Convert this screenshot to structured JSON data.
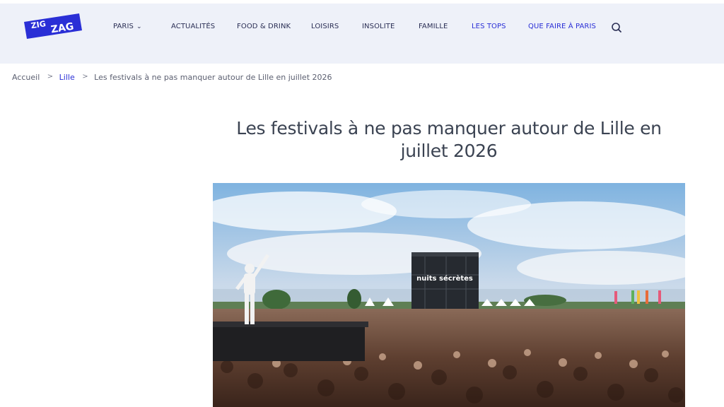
{
  "logo": {
    "line1": "ZIG",
    "line2": "ZAG"
  },
  "nav": [
    {
      "label": "PARIS",
      "dropdown": true
    },
    {
      "label": "ACTUALITÉS"
    },
    {
      "label": "FOOD & DRINK"
    },
    {
      "label": "LOISIRS"
    },
    {
      "label": "INSOLITE"
    },
    {
      "label": "FAMILLE"
    },
    {
      "label": "LES TOPS",
      "accent": true
    },
    {
      "label": "QUE FAIRE À PARIS",
      "accent": true
    }
  ],
  "breadcrumb": {
    "home": "Accueil",
    "section": "Lille",
    "current": "Les festivals à ne pas manquer autour de Lille en juillet 2026",
    "separator": ">"
  },
  "article": {
    "title": "Les festivals à ne pas manquer autour de Lille en juillet 2026"
  },
  "hero": {
    "stage_sign": "nuits sécrètes"
  },
  "colors": {
    "brand": "#2a2fd6",
    "header_bg": "#eef1f9",
    "title": "#3b4352"
  }
}
